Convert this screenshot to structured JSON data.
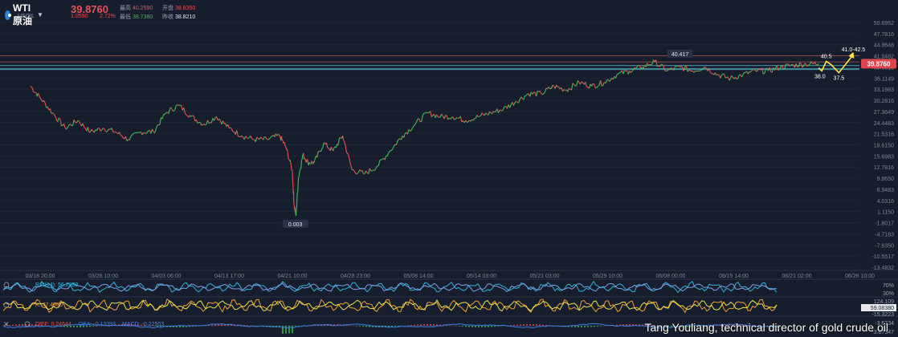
{
  "header": {
    "symbol": "WTI原油",
    "code": "USOIL",
    "price": "39.8760",
    "change": "1.0550",
    "change_pct": "2.72%",
    "high_label": "最高",
    "high": "40.2590",
    "open_label": "开盘",
    "open": "38.8350",
    "low_label": "最低",
    "low": "38.7380",
    "prev_label": "昨收",
    "prev": "38.8210"
  },
  "colors": {
    "background": "#161d2c",
    "up": "#3fbf5a",
    "down": "#ef4e56",
    "price_tag": "#e0454d",
    "forecast": "#ffe84a",
    "rsi": "#2bb6d8",
    "kdj_k": "#f0a030",
    "macd_dea": "#3b7fe8"
  },
  "chart_data": {
    "type": "line",
    "ylim": [
      -13.4832,
      50.6952
    ],
    "y_ticks": [
      "50.6952",
      "47.7816",
      "44.8648",
      "41.9482",
      "39.0316",
      "36.1149",
      "33.1983",
      "30.2816",
      "27.3649",
      "24.4483",
      "21.5316",
      "18.6150",
      "15.6983",
      "12.7816",
      "9.8650",
      "6.9483",
      "4.0316",
      "1.1150",
      "-1.8017",
      "-4.7183",
      "-7.6350",
      "-10.5517",
      "-13.4832"
    ],
    "x_ticks": [
      "03/18 20:00",
      "03/26 10:00",
      "04/03 06:00",
      "04/13 17:00",
      "04/21 10:00",
      "04/28 23:00",
      "05/08 14:00",
      "05/14 03:00",
      "05/21 03:00",
      "05/29 10:00",
      "06/08 00:00",
      "06/15 14:00",
      "06/21 02:00",
      "06/26 10:00"
    ],
    "price_label": "39.8760",
    "annotations": [
      {
        "text": "40.417",
        "x_index": 10.3,
        "y": 40.417
      },
      {
        "text": "0.003",
        "x_index": 4.2,
        "y": 0.003
      },
      {
        "text": "40.5",
        "x_index": 12.62,
        "y": 40.5
      },
      {
        "text": "38.0",
        "x_index": 12.52,
        "y": 38.0
      },
      {
        "text": "37.5",
        "x_index": 12.82,
        "y": 37.5
      },
      {
        "text": "41.0-42.5",
        "x_index": 13.05,
        "y": 42.3
      }
    ],
    "h_lines": [
      41.9482,
      40.35,
      39.4,
      38.6,
      38.35
    ],
    "series": [
      {
        "x_index": [
          0,
          0.15,
          0.35,
          0.55,
          0.75,
          0.95,
          1.15,
          1.35,
          1.55,
          1.75,
          1.95,
          2.15,
          2.35,
          2.55,
          2.75,
          2.95,
          3.15,
          3.35,
          3.55,
          3.75,
          3.95,
          4.05,
          4.15,
          4.18,
          4.21,
          4.25,
          4.32,
          4.4,
          4.5,
          4.65,
          4.8,
          4.95,
          5.1,
          5.3,
          5.5,
          5.7,
          5.9,
          6.1,
          6.3,
          6.5,
          6.7,
          6.9,
          7.1,
          7.3,
          7.5,
          7.7,
          7.9,
          8.1,
          8.3,
          8.5,
          8.7,
          8.9,
          9.1,
          9.3,
          9.5,
          9.7,
          9.9,
          10.1,
          10.3,
          10.5,
          10.7,
          10.9,
          11.1,
          11.3,
          11.5,
          11.7,
          11.9,
          12.1,
          12.3,
          12.5
        ],
        "values": [
          34,
          31,
          27,
          23,
          25,
          22,
          23,
          22,
          20,
          22,
          22,
          27,
          29,
          26,
          24,
          26,
          23,
          21,
          20,
          20,
          21,
          18,
          12,
          3,
          0.003,
          10,
          16,
          14,
          14,
          19,
          17,
          21,
          12,
          11,
          13,
          17,
          21,
          24,
          27,
          26,
          26,
          25,
          26,
          27,
          28,
          30,
          32,
          32,
          34,
          33,
          35,
          34,
          35,
          37,
          38,
          39,
          40.4,
          38,
          39,
          38,
          39,
          37,
          36,
          37,
          38,
          38,
          39,
          39.5,
          39.8,
          39.88
        ]
      }
    ],
    "forecast": {
      "x_index": [
        12.5,
        12.55,
        12.62,
        12.7,
        12.82,
        13.05
      ],
      "values": [
        38.8,
        38.0,
        40.5,
        39.6,
        37.5,
        42.3
      ]
    },
    "indicators": [
      {
        "name": "RSI",
        "value_text": "RSI(14): 56.2999",
        "levels": [
          "70%",
          "30%"
        ]
      },
      {
        "name": "KDJ",
        "value_text": "K: 47.4900",
        "right_value": "59.08380",
        "levels": [
          "124.109",
          "-15.3223"
        ]
      },
      {
        "name": "MACD",
        "diff": "DIFF: 0.24644",
        "dea": "DEA: -0.13393",
        "macd": "MACD: -0.22503",
        "levels": [
          "-3.6734",
          "-3.87347"
        ]
      }
    ]
  },
  "caption": "Tang Youliang, technical director of gold crude oil"
}
